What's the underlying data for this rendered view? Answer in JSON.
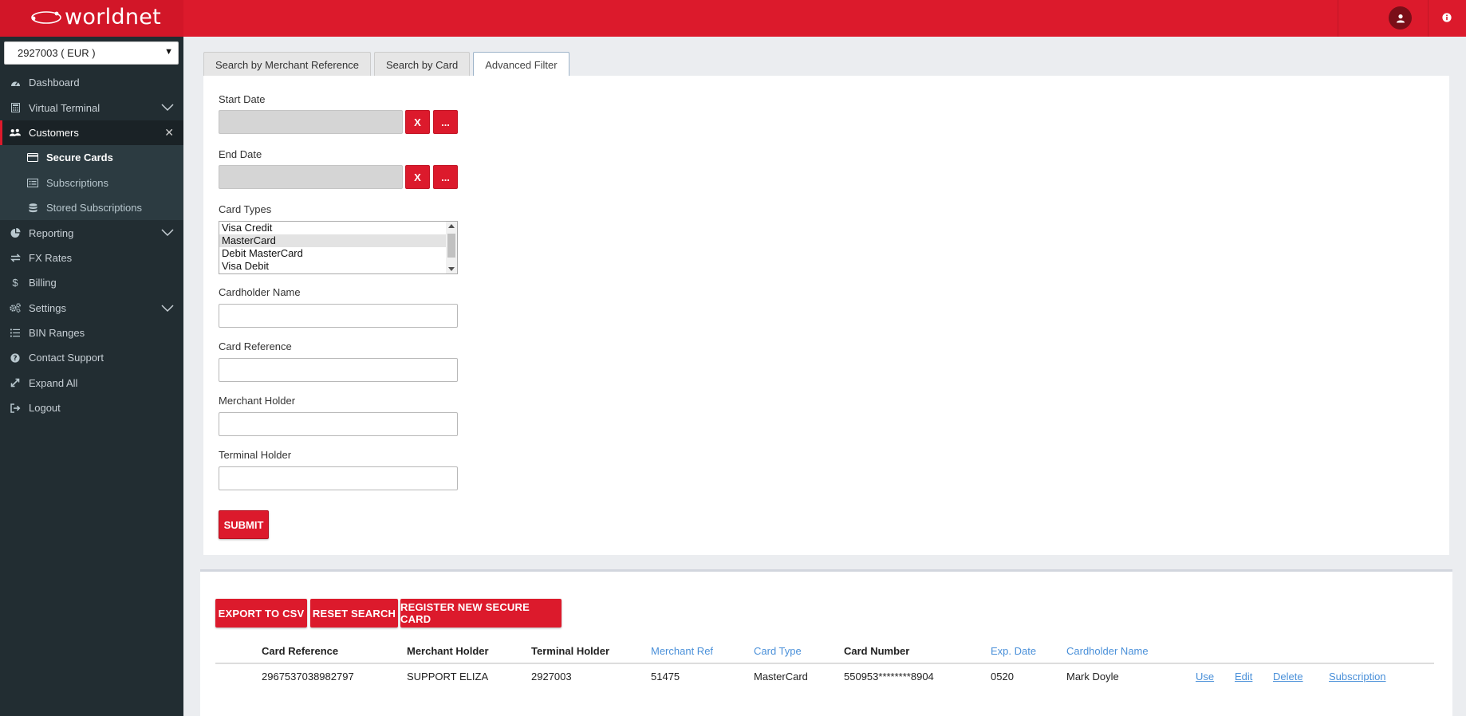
{
  "brand": {
    "name": "worldnet"
  },
  "sidebar": {
    "merchant_select": "2927003 ( EUR )",
    "items": [
      {
        "label": "Dashboard",
        "icon": "dashboard-icon"
      },
      {
        "label": "Virtual Terminal",
        "icon": "calculator-icon"
      },
      {
        "label": "Customers",
        "icon": "users-icon"
      },
      {
        "label": "Reporting",
        "icon": "chart-icon"
      },
      {
        "label": "FX Rates",
        "icon": "exchange-icon"
      },
      {
        "label": "Billing",
        "icon": "dollar-icon"
      },
      {
        "label": "Settings",
        "icon": "cogs-icon"
      },
      {
        "label": "BIN Ranges",
        "icon": "list-icon"
      },
      {
        "label": "Contact Support",
        "icon": "question-icon"
      },
      {
        "label": "Expand All",
        "icon": "expand-icon"
      },
      {
        "label": "Logout",
        "icon": "logout-icon"
      }
    ],
    "customers_sub": [
      {
        "label": "Secure Cards",
        "icon": "credit-card-icon"
      },
      {
        "label": "Subscriptions",
        "icon": "list-alt-icon"
      },
      {
        "label": "Stored Subscriptions",
        "icon": "database-icon"
      }
    ]
  },
  "tabs": [
    {
      "label": "Search by Merchant Reference"
    },
    {
      "label": "Search by Card"
    },
    {
      "label": "Advanced Filter"
    }
  ],
  "filter": {
    "start_date_label": "Start Date",
    "end_date_label": "End Date",
    "clear_label": "X",
    "picker_label": "...",
    "card_types_label": "Card Types",
    "card_types": [
      "Visa Credit",
      "MasterCard",
      "Debit MasterCard",
      "Visa Debit"
    ],
    "selected_card_type": "MasterCard",
    "cardholder_name_label": "Cardholder Name",
    "card_reference_label": "Card Reference",
    "merchant_holder_label": "Merchant Holder",
    "terminal_holder_label": "Terminal Holder",
    "submit_label": "SUBMIT"
  },
  "results": {
    "export_label": "EXPORT TO CSV",
    "reset_label": "RESET SEARCH",
    "register_label": "REGISTER NEW SECURE CARD",
    "columns": [
      "Card Reference",
      "Merchant Holder",
      "Terminal Holder",
      "Merchant Ref",
      "Card Type",
      "Card Number",
      "Exp. Date",
      "Cardholder Name"
    ],
    "rows": [
      {
        "card_reference": "2967537038982797",
        "merchant_holder": "SUPPORT ELIZA",
        "terminal_holder": "2927003",
        "merchant_ref": "51475",
        "card_type": "MasterCard",
        "card_number": "550953********8904",
        "exp_date": "0520",
        "cardholder_name": "Mark Doyle",
        "actions": [
          "Use",
          "Edit",
          "Delete",
          "Subscription"
        ]
      }
    ]
  },
  "colors": {
    "brand_red": "#dc1a2c",
    "sidebar_bg": "#222d32",
    "link_blue": "#4a90d9"
  }
}
